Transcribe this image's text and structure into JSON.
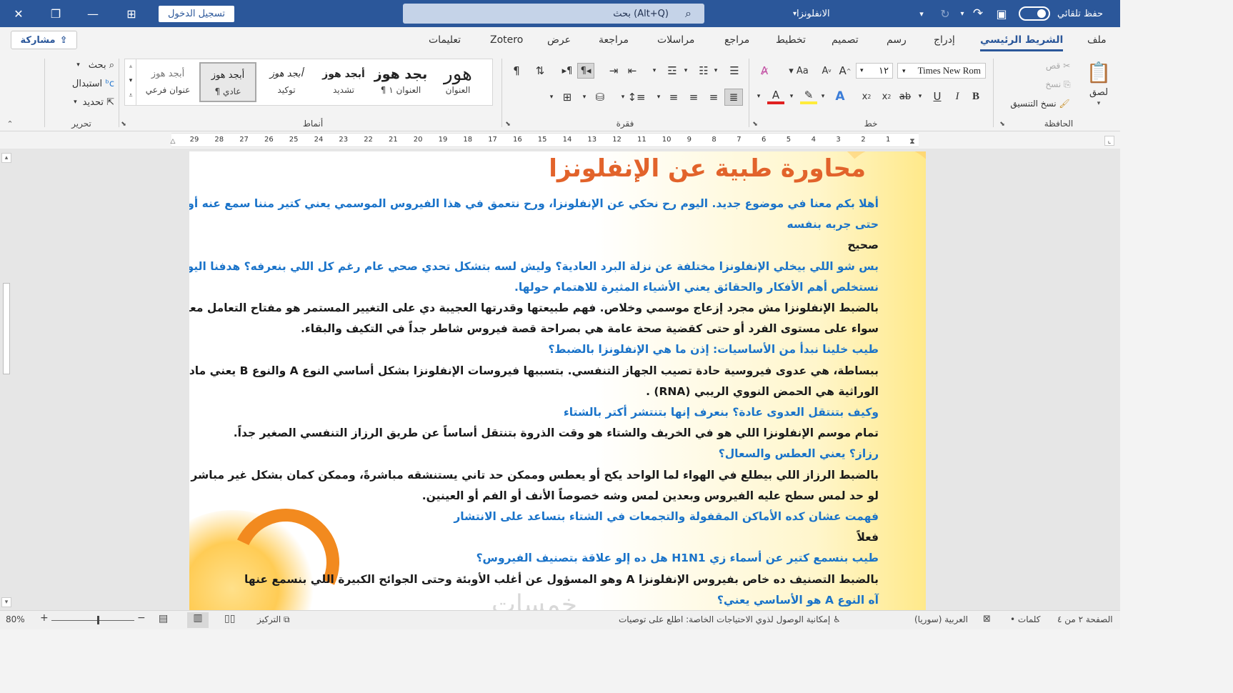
{
  "titlebar": {
    "signin": "تسجيل الدخول",
    "search_placeholder": "بحث (Alt+Q)",
    "filename": "الانفلونزا",
    "autosave": "حفظ تلقائي"
  },
  "tabs": [
    "ملف",
    "الشريط الرئيسي",
    "إدراج",
    "رسم",
    "تصميم",
    "تخطيط",
    "مراجع",
    "مراسلات",
    "مراجعة",
    "عرض",
    "Zotero",
    "تعليمات"
  ],
  "share_label": "مشاركة",
  "ribbon": {
    "clipboard": {
      "label": "الحافظة",
      "paste": "لصق",
      "cut": "قص",
      "copy": "نسخ",
      "format_painter": "نسخ التنسيق"
    },
    "font": {
      "label": "خط",
      "font_name": "Times New Rom",
      "font_size": "١٢"
    },
    "paragraph": {
      "label": "فقرة"
    },
    "styles": {
      "label": "أنماط",
      "items": [
        {
          "preview": "هور",
          "name": "العنوان"
        },
        {
          "preview": "بجد هوز",
          "name": "¶ العنوان ١"
        },
        {
          "preview": "أبجد هوز",
          "name": "تشديد"
        },
        {
          "preview": "أبجد هوز",
          "name": "توكيد"
        },
        {
          "preview": "أبجد هوز",
          "name": "¶ عادي"
        },
        {
          "preview": "أبجد هوز",
          "name": "عنوان فرعي"
        }
      ]
    },
    "editing": {
      "label": "تحرير",
      "find": "بحث",
      "replace": "استبدال",
      "select": "تحديد"
    }
  },
  "ruler_numbers": [
    "1",
    "2",
    "3",
    "4",
    "5",
    "6",
    "7",
    "8",
    "9",
    "10",
    "11",
    "12",
    "13",
    "14",
    "15",
    "16",
    "17",
    "18",
    "19",
    "20",
    "21",
    "22",
    "23",
    "24",
    "25",
    "26",
    "27",
    "28",
    "29"
  ],
  "document": {
    "title": "محاورة طبية عن الإنفلونزا",
    "lines": [
      {
        "type": "q",
        "text": "أهلا بكم معنا في موضوع جديد. اليوم رح نحكي عن الإنفلونزا، ورح نتعمق في هذا الفيروس الموسمي يعني كتير مننا سمع عنه أو"
      },
      {
        "type": "q",
        "text": "حتى جربه بنفسه"
      },
      {
        "type": "a",
        "text": "صحيح"
      },
      {
        "type": "q",
        "text": "بس شو اللي بيخلي الإنفلونزا مختلفة عن نزلة البرد العادية؟ وليش لسه بتشكل تحدي صحي عام رغم كل اللي بنعرفه؟ هدفنا اليوم"
      },
      {
        "type": "q",
        "text": "نستخلص أهم الأفكار والحقائق يعني الأشياء المثيرة للاهتمام حولها."
      },
      {
        "type": "a",
        "text": "بالضبط الإنفلونزا مش مجرد إزعاج موسمي وخلاص. فهم طبيعتها وقدرتها العجيبة دي على التغيير المستمر هو مفتاح التعامل معها"
      },
      {
        "type": "a",
        "text": "سواء على مستوى الفرد أو حتى كقضية صحة عامة هي بصراحة قصة فيروس شاطر جداً في التكيف والبقاء."
      },
      {
        "type": "q",
        "text": "طيب خلينا نبدأ من الأساسيات: إذن ما هي الإنفلونزا بالضبط؟"
      },
      {
        "type": "a",
        "text": "ببساطة، هي عدوى فيروسية حادة تصيب الجهاز التنفسي. بتسببها فيروسات الإنفلونزا بشكل أساسي النوع A والنوع B يعني مادتها"
      },
      {
        "type": "a",
        "text": "الوراثية هي الحمض النووي الريبي (RNA) ."
      },
      {
        "type": "q",
        "text": "وكيف بتنتقل العدوى عادة؟ بنعرف إنها بتنتشر أكتر بالشتاء"
      },
      {
        "type": "a",
        "text": "تمام موسم الإنفلونزا اللي هو في الخريف والشتاء هو وقت الذروة بتنتقل أساساً عن طريق الرزاز التنفسي الصغير جداً."
      },
      {
        "type": "q",
        "text": "رزاز؟ يعني العطس والسعال؟"
      },
      {
        "type": "a",
        "text": "بالضبط الرزاز اللي بيطلع في الهواء لما الواحد يكح أو يعطس وممكن حد تاني يستنشقه مباشرةً، وممكن كمان بشكل غير مباشر يعني"
      },
      {
        "type": "a",
        "text": "لو حد لمس سطح عليه الفيروس وبعدين لمس وشه خصوصاً الأنف أو الفم أو العينين."
      },
      {
        "type": "q",
        "text": "فهمت عشان كده الأماكن المقفولة والتجمعات في الشتاء بتساعد على الانتشار"
      },
      {
        "type": "a",
        "text": "فعلاً"
      },
      {
        "type": "q",
        "text": "طيب بنسمع كتير عن أسماء زي H1N1 هل ده إلو علاقة بتصنيف الفيروس؟"
      },
      {
        "type": "a",
        "text": "بالضبط التصنيف ده خاص بفيروس الإنفلونزا A وهو المسؤول عن أغلب الأوبئة وحتى الجوائح الكبيرة اللي بنسمع عنها"
      },
      {
        "type": "q",
        "text": "آه النوع A هو الأساسي يعني؟"
      }
    ]
  },
  "watermark": "خمسات",
  "statusbar": {
    "page": "الصفحة ٢ من ٤",
    "words": "• كلمات",
    "language": "العربية (سوريا)",
    "accessibility": "إمكانية الوصول لذوي الاحتياجات الخاصة: اطلع على توصيات",
    "focus": "التركيز",
    "zoom": "80%",
    "zoom_fraction": 0.55
  }
}
